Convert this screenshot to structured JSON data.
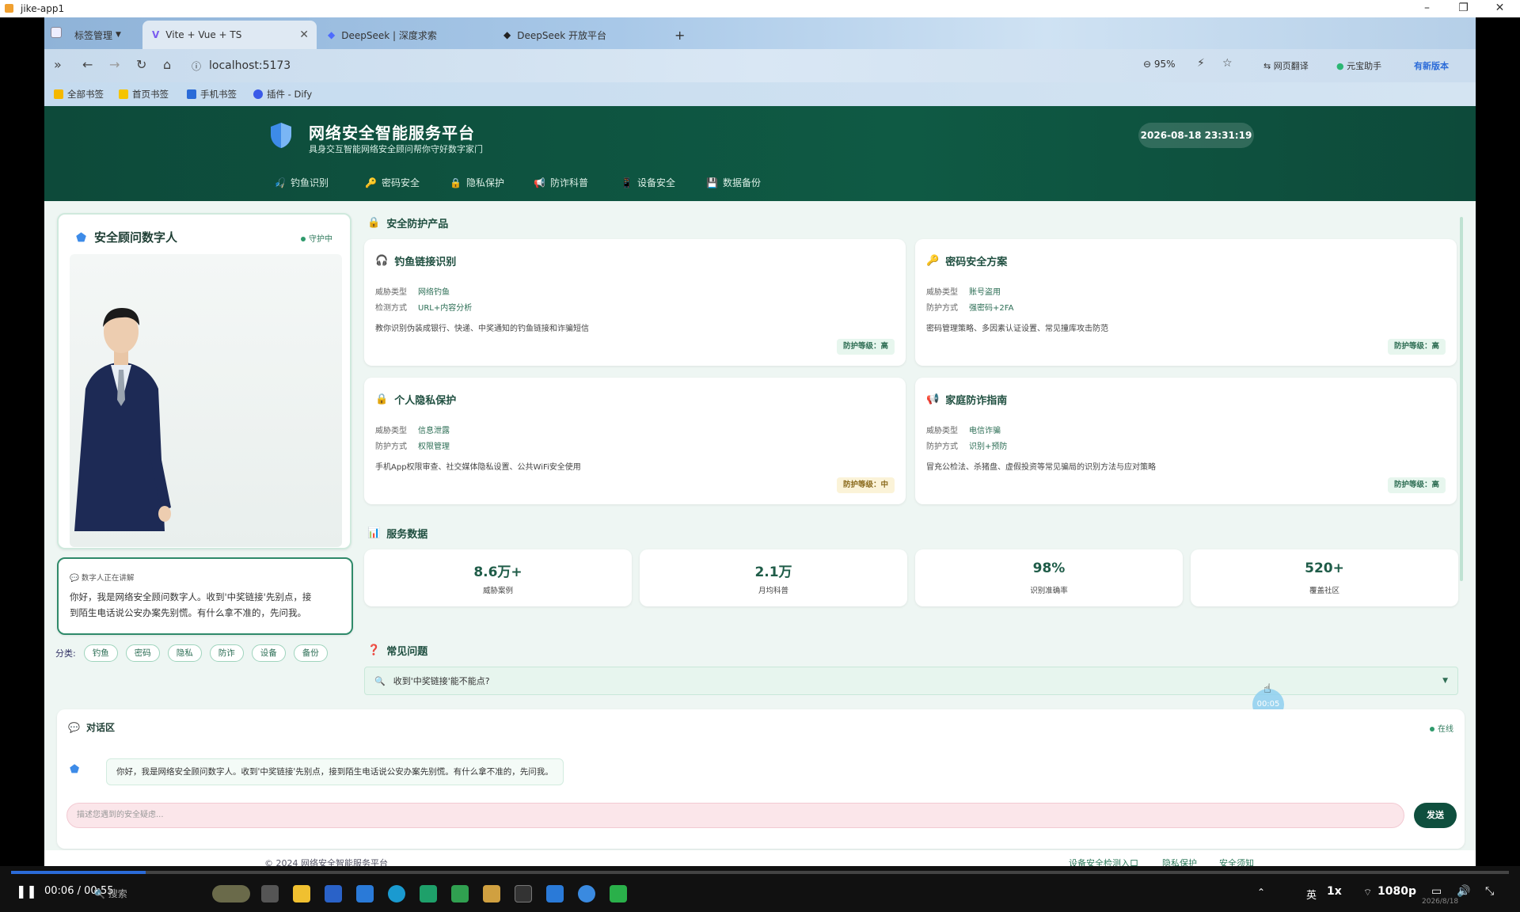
{
  "window": {
    "title": "jike-app1"
  },
  "tabs": {
    "group_label": "标签管理",
    "items": [
      {
        "label": "Vite + Vue + TS"
      },
      {
        "label": "DeepSeek | 深度求索"
      },
      {
        "label": "DeepSeek 开放平台"
      }
    ],
    "new_tab": "+"
  },
  "nav": {
    "url": "localhost:5173",
    "zoom": "95%",
    "translate": "网页翻译",
    "assistant": "元宝助手",
    "update": "有新版本"
  },
  "bookmarks": [
    "全部书签",
    "首页书签",
    "手机书签",
    "插件 - Dify"
  ],
  "header": {
    "title": "网络安全智能服务平台",
    "subtitle": "具身交互智能网络安全顾问帮你守好数字家门",
    "datetime": "2026-08-18 23:31:19",
    "menu": [
      "钓鱼识别",
      "密码安全",
      "隐私保护",
      "防诈科普",
      "设备安全",
      "数据备份"
    ]
  },
  "advisor": {
    "title": "安全顾问数字人",
    "status": "守护中"
  },
  "speech": {
    "label": "数字人正在讲解",
    "text_line1": "你好，我是网络安全顾问数字人。收到'中奖链接'先别点，接",
    "text_line2": "到陌生电话说公安办案先别慌。有什么拿不准的，先问我。"
  },
  "categories": {
    "label": "分类:",
    "items": [
      "钓鱼",
      "密码",
      "隐私",
      "防诈",
      "设备",
      "备份"
    ]
  },
  "products": {
    "section_title": "安全防护产品",
    "items": [
      {
        "name": "钓鱼链接识别",
        "k1": "威胁类型",
        "v1": "网络钓鱼",
        "k2": "检测方式",
        "v2": "URL+内容分析",
        "desc": "教你识别伪装成银行、快递、中奖通知的钓鱼链接和诈骗短信",
        "level": "防护等级：高"
      },
      {
        "name": "密码安全方案",
        "k1": "威胁类型",
        "v1": "账号盗用",
        "k2": "防护方式",
        "v2": "强密码+2FA",
        "desc": "密码管理策略、多因素认证设置、常见撞库攻击防范",
        "level": "防护等级：高"
      },
      {
        "name": "个人隐私保护",
        "k1": "威胁类型",
        "v1": "信息泄露",
        "k2": "防护方式",
        "v2": "权限管理",
        "desc": "手机App权限审查、社交媒体隐私设置、公共WiFi安全使用",
        "level": "防护等级：中"
      },
      {
        "name": "家庭防诈指南",
        "k1": "威胁类型",
        "v1": "电信诈骗",
        "k2": "防护方式",
        "v2": "识别+预防",
        "desc": "冒充公检法、杀猪盘、虚假投资等常见骗局的识别方法与应对策略",
        "level": "防护等级：高"
      }
    ]
  },
  "stats": {
    "section_title": "服务数据",
    "items": [
      {
        "value": "8.6万+",
        "label": "威胁案例"
      },
      {
        "value": "2.1万",
        "label": "月均科普"
      },
      {
        "value": "98%",
        "label": "识别准确率"
      },
      {
        "value": "520+",
        "label": "覆盖社区"
      }
    ]
  },
  "faq": {
    "section_title": "常见问题",
    "question": "收到'中奖链接'能不能点?",
    "arrow": "▼"
  },
  "timer_bubble": "00:05",
  "dialog": {
    "title": "对话区",
    "status": "在线",
    "message": "你好，我是网络安全顾问数字人。收到'中奖链接'先别点，接到陌生电话说公安办案先别慌。有什么拿不准的，先问我。",
    "placeholder": "描述您遇到的安全疑虑...",
    "send": "发送"
  },
  "footer": {
    "copyright": "© 2024 网络安全智能服务平台",
    "links": [
      "设备安全检测入口",
      "隐私保护",
      "安全须知"
    ]
  },
  "player": {
    "time": "00:06 / 00:55",
    "progress": 0.09,
    "speed": "1x",
    "quality": "1080p",
    "search": "搜索",
    "ime": "英",
    "date": "2026/8/18"
  },
  "colors": {
    "primary": "#0f4f3e",
    "accent": "#2f9a6c"
  }
}
